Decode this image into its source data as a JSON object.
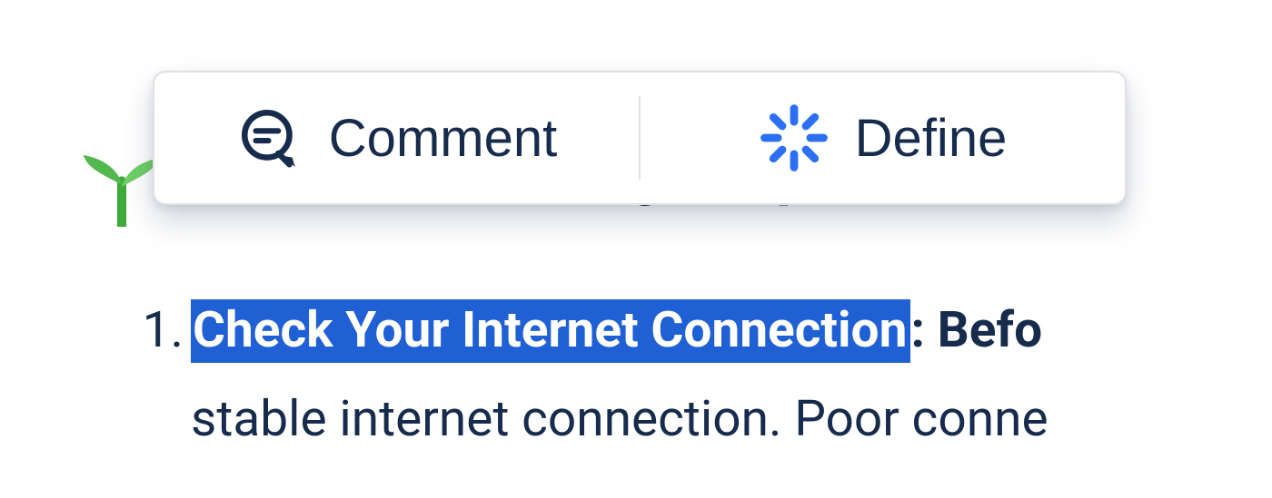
{
  "popover": {
    "comment_label": "Comment",
    "define_label": "Define"
  },
  "heading": {
    "text": "Troubleshooting Steps"
  },
  "list": {
    "item1": {
      "number": "1.",
      "selected_bold": "Check Your Internet Connection",
      "after_selection": ": Befo",
      "line2": "stable internet connection. Poor conne"
    }
  }
}
